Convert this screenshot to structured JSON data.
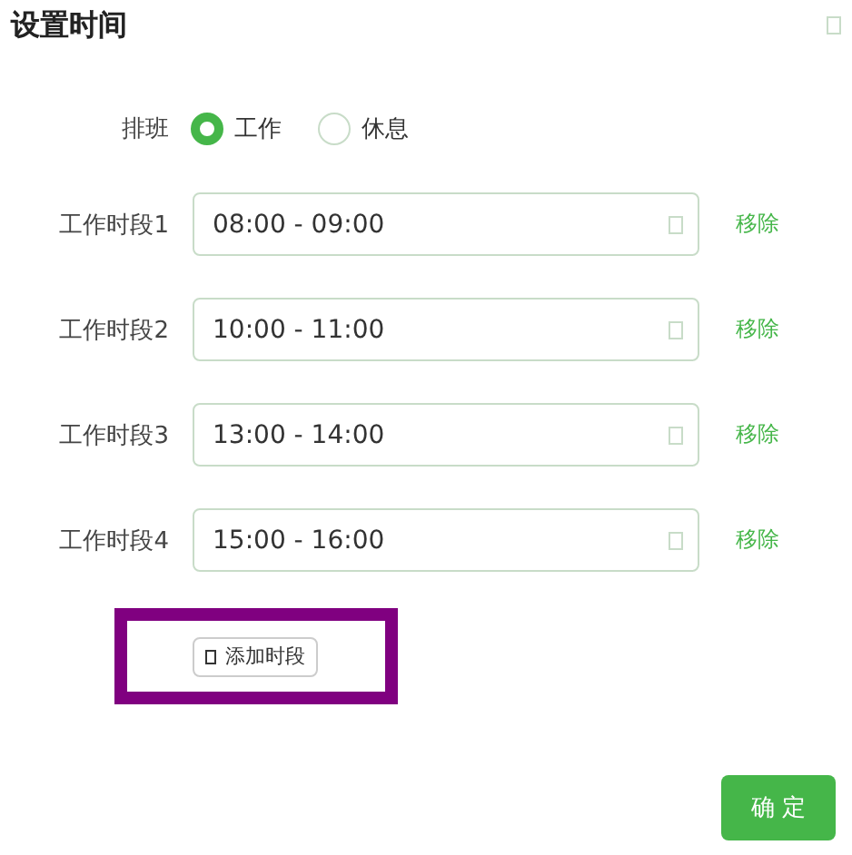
{
  "dialog": {
    "title": "设置时间"
  },
  "shift": {
    "label": "排班",
    "options": [
      {
        "label": "工作",
        "selected": true
      },
      {
        "label": "休息",
        "selected": false
      }
    ]
  },
  "periods": [
    {
      "label": "工作时段1",
      "value": "08:00 - 09:00",
      "action": "移除"
    },
    {
      "label": "工作时段2",
      "value": "10:00 - 11:00",
      "action": "移除"
    },
    {
      "label": "工作时段3",
      "value": "13:00 - 14:00",
      "action": "移除"
    },
    {
      "label": "工作时段4",
      "value": "15:00 - 16:00",
      "action": "移除"
    }
  ],
  "add_button": {
    "label": "添加时段",
    "highlighted": true
  },
  "confirm_button": "确 定"
}
